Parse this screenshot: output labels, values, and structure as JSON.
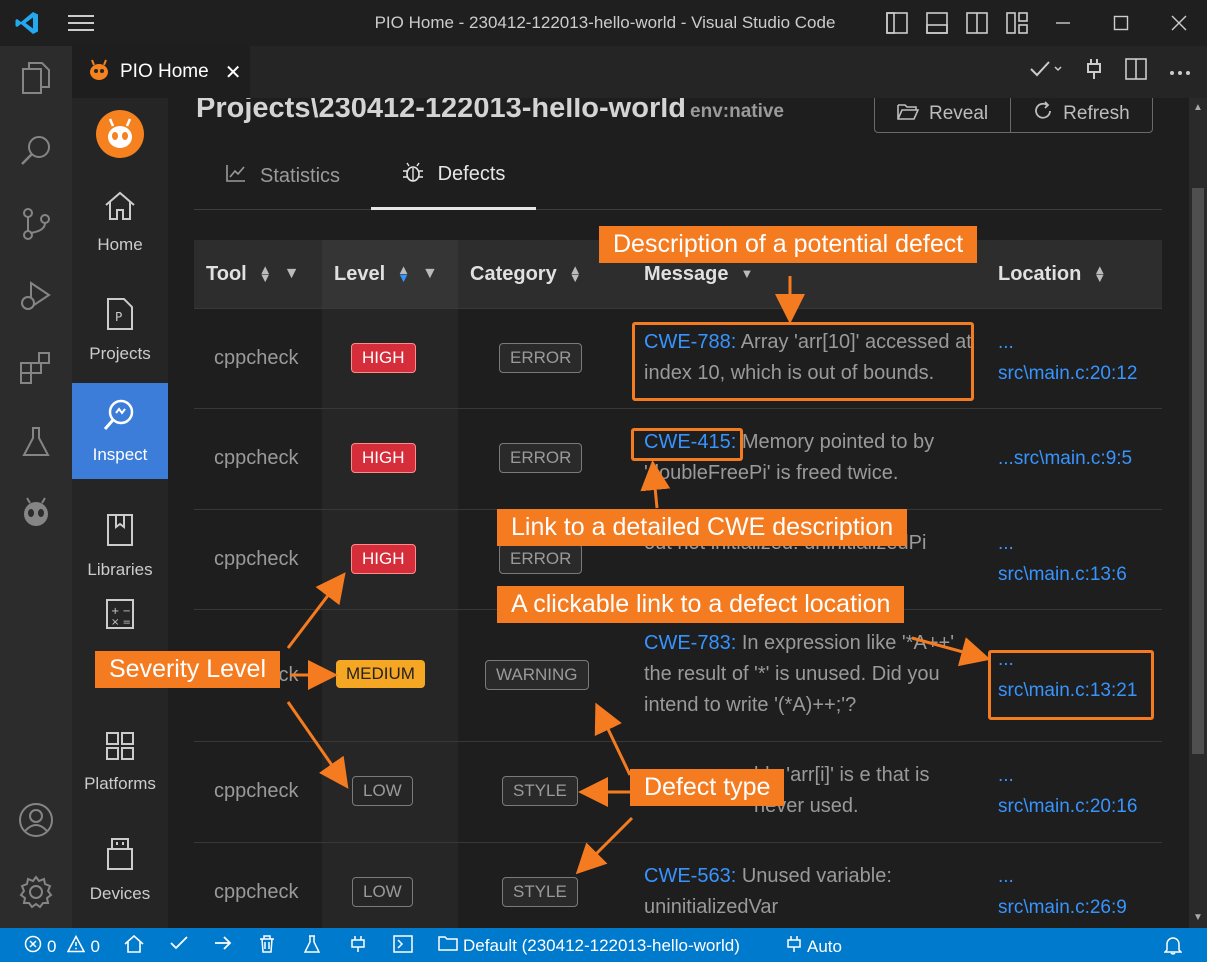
{
  "window": {
    "title": "PIO Home - 230412-122013-hello-world - Visual Studio Code"
  },
  "tab": {
    "label": "PIO Home",
    "close": "✕"
  },
  "sidebar": {
    "items": [
      {
        "label": "Home"
      },
      {
        "label": "Projects"
      },
      {
        "label": "Inspect"
      },
      {
        "label": "Libraries"
      },
      {
        "label": "Platforms"
      },
      {
        "label": "Devices"
      }
    ]
  },
  "header": {
    "project": "Projects\\230412-122013-hello-world",
    "env": "env:native",
    "reveal": "Reveal",
    "refresh": "Refresh"
  },
  "inspect_tabs": [
    {
      "label": "Statistics"
    },
    {
      "label": "Defects"
    }
  ],
  "table": {
    "columns": [
      "Tool",
      "Level",
      "Category",
      "Message",
      "Location"
    ],
    "rows": [
      {
        "tool": "cppcheck",
        "level": "HIGH",
        "category": "ERROR",
        "cwe": "CWE-788:",
        "message": "Array 'arr[10]' accessed at index 10, which is out of bounds.",
        "location_prefix": "...",
        "location": "src\\main.c:20:12"
      },
      {
        "tool": "cppcheck",
        "level": "HIGH",
        "category": "ERROR",
        "cwe": "CWE-415:",
        "message": "Memory pointed to by 'doubleFreePi' is freed twice.",
        "location_prefix": "...",
        "location": "src\\main.c:9:5"
      },
      {
        "tool": "cppcheck",
        "level": "HIGH",
        "category": "ERROR",
        "cwe": "",
        "message": "out not initialized: uninitializedPi",
        "location_prefix": "...",
        "location": "src\\main.c:13:6"
      },
      {
        "tool": "cppcheck",
        "level": "MEDIUM",
        "category": "WARNING",
        "cwe": "CWE-783:",
        "message": "In expression like '*A++' the result of '*' is unused. Did you intend to write '(*A)++;'?",
        "location_prefix": "...",
        "location": "src\\main.c:13:21"
      },
      {
        "tool": "cppcheck",
        "level": "LOW",
        "category": "STYLE",
        "cwe": "",
        "message": "ble 'arr[i]' is e that is never used.",
        "location_prefix": "...",
        "location": "src\\main.c:20:16"
      },
      {
        "tool": "cppcheck",
        "level": "LOW",
        "category": "STYLE",
        "cwe": "CWE-563:",
        "message": "Unused variable: uninitializedVar",
        "location_prefix": "...",
        "location": "src\\main.c:26:9"
      }
    ]
  },
  "statusbar": {
    "errors": "0",
    "warnings": "0",
    "env": "Default (230412-122013-hello-world)",
    "port": "Auto"
  },
  "annotations": {
    "description": "Description of a potential defect",
    "cwe_link": "Link to a detailed CWE description",
    "location_link": "A clickable link to a defect location",
    "severity": "Severity Level",
    "defect_type": "Defect type"
  },
  "colors": {
    "accent": "#3b7dd8",
    "statusbar": "#007acc",
    "annotation": "#f47b20",
    "high": "#d52d3a",
    "medium": "#f5a623",
    "link": "#3794ff"
  }
}
